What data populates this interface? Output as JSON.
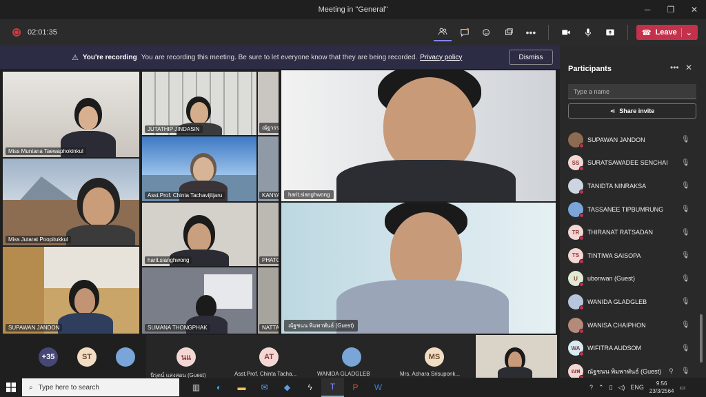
{
  "window": {
    "title": "Meeting in \"General\"",
    "minimize": "─",
    "maximize": "❐",
    "close": "✕"
  },
  "toolbar": {
    "timer": "02:01:35",
    "leave_label": "Leave",
    "leave_chevron": "⌄"
  },
  "banner": {
    "icon": "⚠",
    "title": "You're recording",
    "text": "You are recording this meeting. Be sure to let everyone know that they are being recorded.",
    "link": "Privacy policy",
    "dismiss_label": "Dismiss"
  },
  "stage": {
    "tiles": [
      {
        "name": "Miss Muntana Taewaphokinkul"
      },
      {
        "name": "JUTATHIP JINDASIN"
      },
      {
        "name": "Asst.Prof. Chinta Tachavijitjaru"
      },
      {
        "name": "Miss Jutarat Poopitukkul"
      },
      {
        "name": "harit.sianghwong"
      },
      {
        "name": "SUPAWAN JANDON"
      },
      {
        "name": "SUMANA THONGPHAK"
      },
      {
        "name": "KANYA"
      },
      {
        "name": "PHATC"
      },
      {
        "name": "NATTA"
      },
      {
        "name": "ณัฐวรรณ"
      }
    ],
    "featured": [
      {
        "name": "harit.sianghwong"
      },
      {
        "name": "ณัฐชนน พิมพาพันธ์ (Guest)"
      }
    ]
  },
  "bottom": {
    "overflow_count": "+35",
    "items": [
      {
        "initials": "ST",
        "name": ""
      },
      {
        "initials": "นแ",
        "name": "นิรุตน์ แสงสอน (Guest)"
      },
      {
        "initials": "AT",
        "name": "Asst.Prof. Chinta Tacha..."
      },
      {
        "initials": "",
        "name": "WANIDA GLADGLEB"
      },
      {
        "initials": "MS",
        "name": "Mrs. Achara Srisuponk..."
      }
    ]
  },
  "panel": {
    "title": "Participants",
    "search_placeholder": "Type a name",
    "share_label": "Share invite",
    "participants": [
      {
        "initials": "",
        "name": "SUPAWAN JANDON",
        "color": "#8c6b52"
      },
      {
        "initials": "SS",
        "name": "SURATSAWADEE SENCHAI",
        "color": "#f3d7d4"
      },
      {
        "initials": "",
        "name": "TANIDTA NINRAKSA",
        "color": "#cdd5e0"
      },
      {
        "initials": "",
        "name": "TASSANEE TIPBUMRUNG",
        "color": "#7aa5d8"
      },
      {
        "initials": "TR",
        "name": "THIRANAT RATSADAN",
        "color": "#f3d7d4"
      },
      {
        "initials": "TS",
        "name": "TINTIWA SAISOPA",
        "color": "#f3d7d4"
      },
      {
        "initials": "U",
        "name": "ubonwan (Guest)",
        "color": "#dfead2"
      },
      {
        "initials": "",
        "name": "WANIDA GLADGLEB",
        "color": "#b8c6dc"
      },
      {
        "initials": "",
        "name": "WANISA CHAIPHON",
        "color": "#b48a7a"
      },
      {
        "initials": "WA",
        "name": "WIFITRA AUDSOM",
        "color": "#d6ecf3"
      },
      {
        "initials": "ณพ",
        "name": "ณัฐชนน พิมพาพันธ์ (Guest)",
        "color": "#f3d7d4"
      }
    ]
  },
  "taskbar": {
    "search_placeholder": "Type here to search",
    "lang": "ENG",
    "time": "9:56",
    "date": "23/3/2564"
  },
  "colors": {
    "accent": "#7f85f5",
    "leave": "#c4314b",
    "banner": "#2d2c45"
  }
}
